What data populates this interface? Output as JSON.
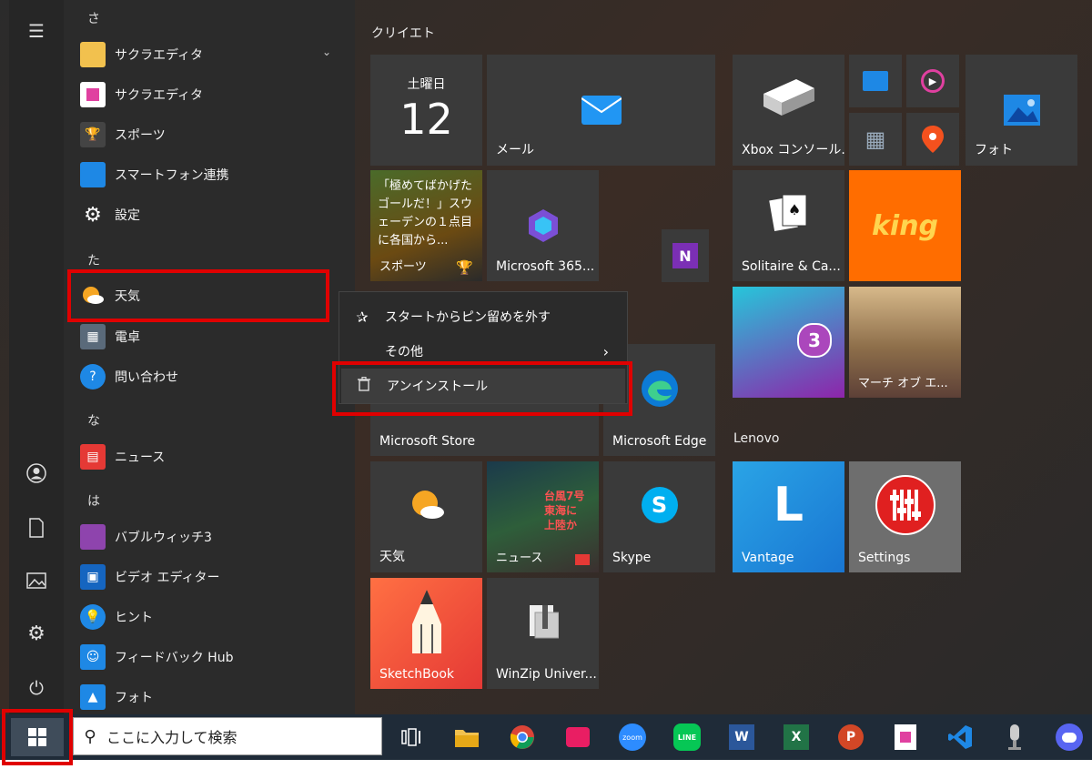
{
  "applist": {
    "headers": {
      "sa": "さ",
      "ta": "た",
      "na": "な",
      "ha": "は"
    },
    "items": [
      {
        "label": "サクラエディタ"
      },
      {
        "label": "サクラエディタ"
      },
      {
        "label": "スポーツ"
      },
      {
        "label": "スマートフォン連携"
      },
      {
        "label": "設定"
      },
      {
        "label": "天気"
      },
      {
        "label": "電卓"
      },
      {
        "label": "問い合わせ"
      },
      {
        "label": "ニュース"
      },
      {
        "label": "バブルウィッチ3"
      },
      {
        "label": "ビデオ エディター"
      },
      {
        "label": "ヒント"
      },
      {
        "label": "フィードバック Hub"
      },
      {
        "label": "フォト"
      }
    ]
  },
  "groups": {
    "create": "クリイエト",
    "lenovo": "Lenovo"
  },
  "tiles": {
    "calendar_day": "土曜日",
    "calendar_date": "12",
    "mail": "メール",
    "sports_headline": "「極めてばかげたゴールだ！」スウェーデンの１点目に各国から...",
    "sports": "スポーツ",
    "m365": "Microsoft 365...",
    "xbox": "Xbox コンソール...",
    "photos": "フォト",
    "solitaire": "Solitaire & Ca...",
    "king": "king",
    "bubble_number": "3",
    "store": "Microsoft Store",
    "edge": "Microsoft Edge",
    "weather": "天気",
    "news": "ニュース",
    "news_headline": "台風7号 東海に 上陸か",
    "skype": "Skype",
    "vantage": "Vantage",
    "vantage_letter": "L",
    "settings": "Settings",
    "sketchbook": "SketchBook",
    "winzip": "WinZip Univer...",
    "empire": "マーチ オブ エ..."
  },
  "context_menu": {
    "unpin": "スタートからピン留めを外す",
    "more": "その他",
    "uninstall": "アンインストール"
  },
  "taskbar": {
    "search_placeholder": "ここに入力して検索",
    "zoom": "zoom",
    "line": "LINE",
    "word": "W",
    "excel": "X",
    "powerpoint": "P"
  },
  "colors": {
    "highlight": "#e00000",
    "taskbar": "#1f2b38",
    "tile_dark": "#3a3a3a"
  }
}
